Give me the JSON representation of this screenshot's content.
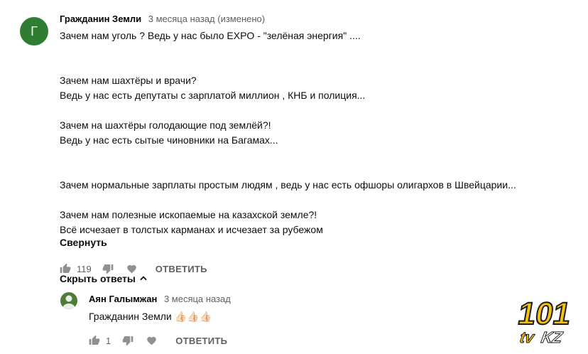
{
  "comment": {
    "avatar_letter": "Г",
    "author": "Гражданин Земли",
    "time": "3 месяца назад (изменено)",
    "lines": [
      "Зачем нам уголь ? Ведь у нас было EXPO - \"зелёная энергия\" ....",
      "",
      "",
      "Зачем нам шахтёры и врачи?",
      "Ведь у нас есть депутаты с зарплатой миллион , КНБ и полиция...",
      "",
      "Зачем на шахтёры голодающие под землёй?!",
      "Ведь у нас есть сытые чиновники на Багамах...",
      "",
      "",
      "Зачем нормальные зарплаты простым людям , ведь у нас есть офшоры олигархов в Швейцарии...",
      "",
      "Зачем нам полезные ископаемые на казахской земле?!",
      "Всё исчезает в толстых карманах и исчезает за рубежом"
    ],
    "collapse_label": "Свернуть",
    "likes": "119",
    "reply_label": "ОТВЕТИТЬ"
  },
  "replies_toggle": {
    "label": "Скрыть ответы"
  },
  "reply": {
    "author": "Аян Галымжан",
    "time": "3 месяца назад",
    "text": "Гражданин Земли 👍🏻👍🏻👍🏻",
    "likes": "1",
    "reply_label": "ОТВЕТИТЬ"
  },
  "watermark": {
    "number": "101",
    "suffix": "tv",
    "domain": "KZ"
  },
  "colors": {
    "avatar_main": "#2e7d32",
    "icon_gray": "#909090",
    "meta_gray": "#606060",
    "logo_yellow": "#f4c20d"
  }
}
